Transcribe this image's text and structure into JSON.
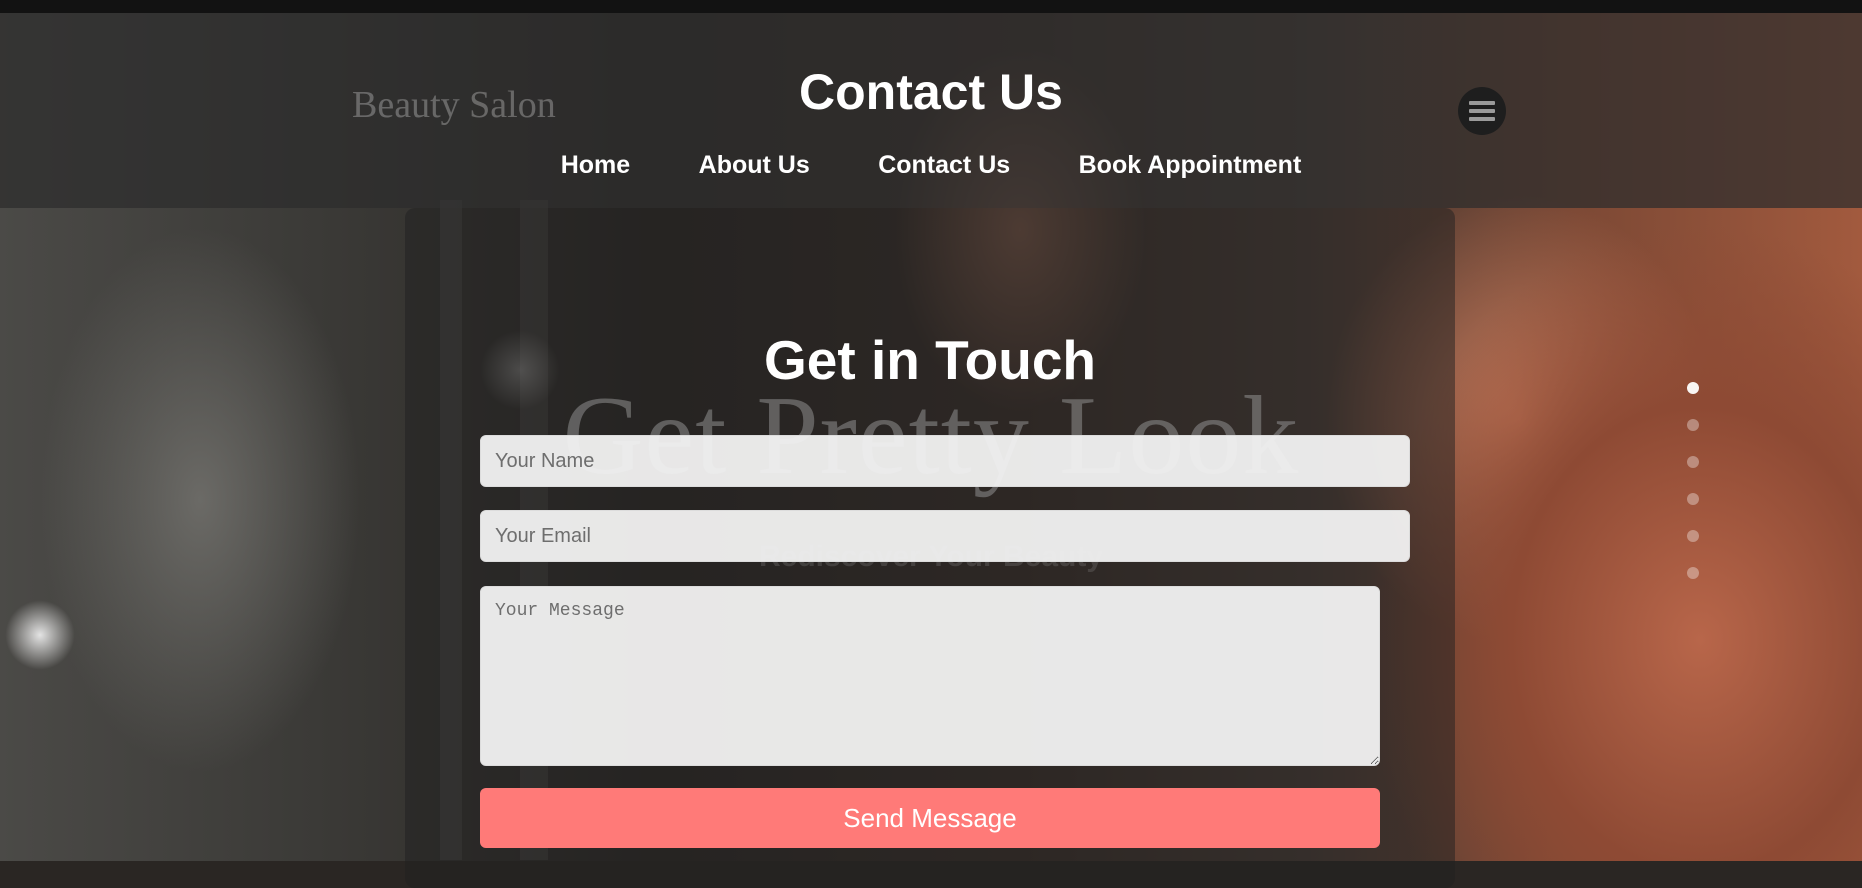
{
  "header": {
    "brand": "Beauty Salon",
    "title": "Contact Us",
    "menu_icon": "hamburger-menu-icon",
    "nav": [
      {
        "label": "Home"
      },
      {
        "label": "About Us"
      },
      {
        "label": "Contact Us"
      },
      {
        "label": "Book Appointment"
      }
    ]
  },
  "hero": {
    "title": "Get Pretty Look",
    "subtitle": "Rediscover Your Beauty",
    "slides_count": 6,
    "active_slide": 1
  },
  "contact_form": {
    "title": "Get in Touch",
    "name_placeholder": "Your Name",
    "email_placeholder": "Your Email",
    "message_placeholder": "Your Message",
    "submit_label": "Send Message"
  },
  "colors": {
    "accent": "#ff7a78",
    "header_overlay": "#2d2d2d",
    "text": "#ffffff"
  }
}
